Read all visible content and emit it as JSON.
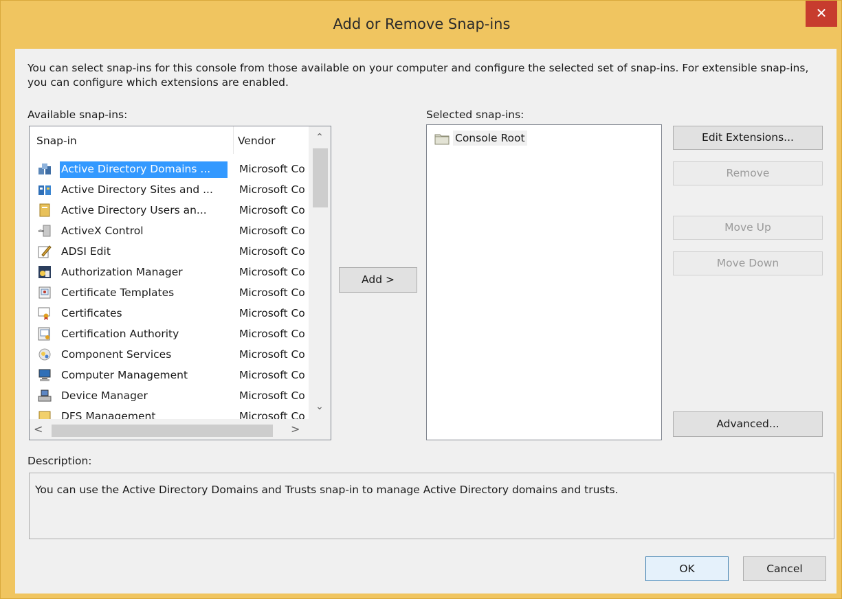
{
  "window": {
    "title": "Add or Remove Snap-ins",
    "close_glyph": "✕"
  },
  "intro_text": "You can select snap-ins for this console from those available on your computer and configure the selected set of snap-ins. For extensible snap-ins, you can configure which extensions are enabled.",
  "available": {
    "label": "Available snap-ins:",
    "columns": {
      "snapin": "Snap-in",
      "vendor": "Vendor"
    },
    "items": [
      {
        "name": "Active Directory Domains ...",
        "vendor": "Microsoft Co",
        "icon": "domains-trusts-icon"
      },
      {
        "name": "Active Directory Sites and ...",
        "vendor": "Microsoft Co",
        "icon": "sites-services-icon"
      },
      {
        "name": "Active Directory Users an...",
        "vendor": "Microsoft Co",
        "icon": "users-computers-icon"
      },
      {
        "name": "ActiveX Control",
        "vendor": "Microsoft Co",
        "icon": "activex-icon"
      },
      {
        "name": "ADSI Edit",
        "vendor": "Microsoft Co",
        "icon": "adsi-edit-icon"
      },
      {
        "name": "Authorization Manager",
        "vendor": "Microsoft Co",
        "icon": "authorization-manager-icon"
      },
      {
        "name": "Certificate Templates",
        "vendor": "Microsoft Co",
        "icon": "certificate-templates-icon"
      },
      {
        "name": "Certificates",
        "vendor": "Microsoft Co",
        "icon": "certificates-icon"
      },
      {
        "name": "Certification Authority",
        "vendor": "Microsoft Co",
        "icon": "certification-authority-icon"
      },
      {
        "name": "Component Services",
        "vendor": "Microsoft Co",
        "icon": "component-services-icon"
      },
      {
        "name": "Computer Management",
        "vendor": "Microsoft Co",
        "icon": "computer-management-icon"
      },
      {
        "name": "Device Manager",
        "vendor": "Microsoft Co",
        "icon": "device-manager-icon"
      },
      {
        "name": "DFS Management",
        "vendor": "Microsoft Co",
        "icon": "dfs-management-icon"
      }
    ],
    "selected_index": 0
  },
  "buttons": {
    "add": "Add >",
    "edit_extensions": "Edit Extensions...",
    "remove": "Remove",
    "move_up": "Move Up",
    "move_down": "Move Down",
    "advanced": "Advanced...",
    "ok": "OK",
    "cancel": "Cancel"
  },
  "selected": {
    "label": "Selected snap-ins:",
    "items": [
      {
        "name": "Console Root",
        "icon": "folder-icon"
      }
    ]
  },
  "description": {
    "label": "Description:",
    "text": "You can use the Active Directory Domains and Trusts snap-in to manage Active Directory domains and trusts."
  },
  "scroll_glyphs": {
    "up": "⌃",
    "down": "⌄",
    "left": "<",
    "right": ">"
  },
  "colors": {
    "title_bar": "#f0c560",
    "selection": "#3399ff",
    "close_button": "#c73c2e"
  }
}
